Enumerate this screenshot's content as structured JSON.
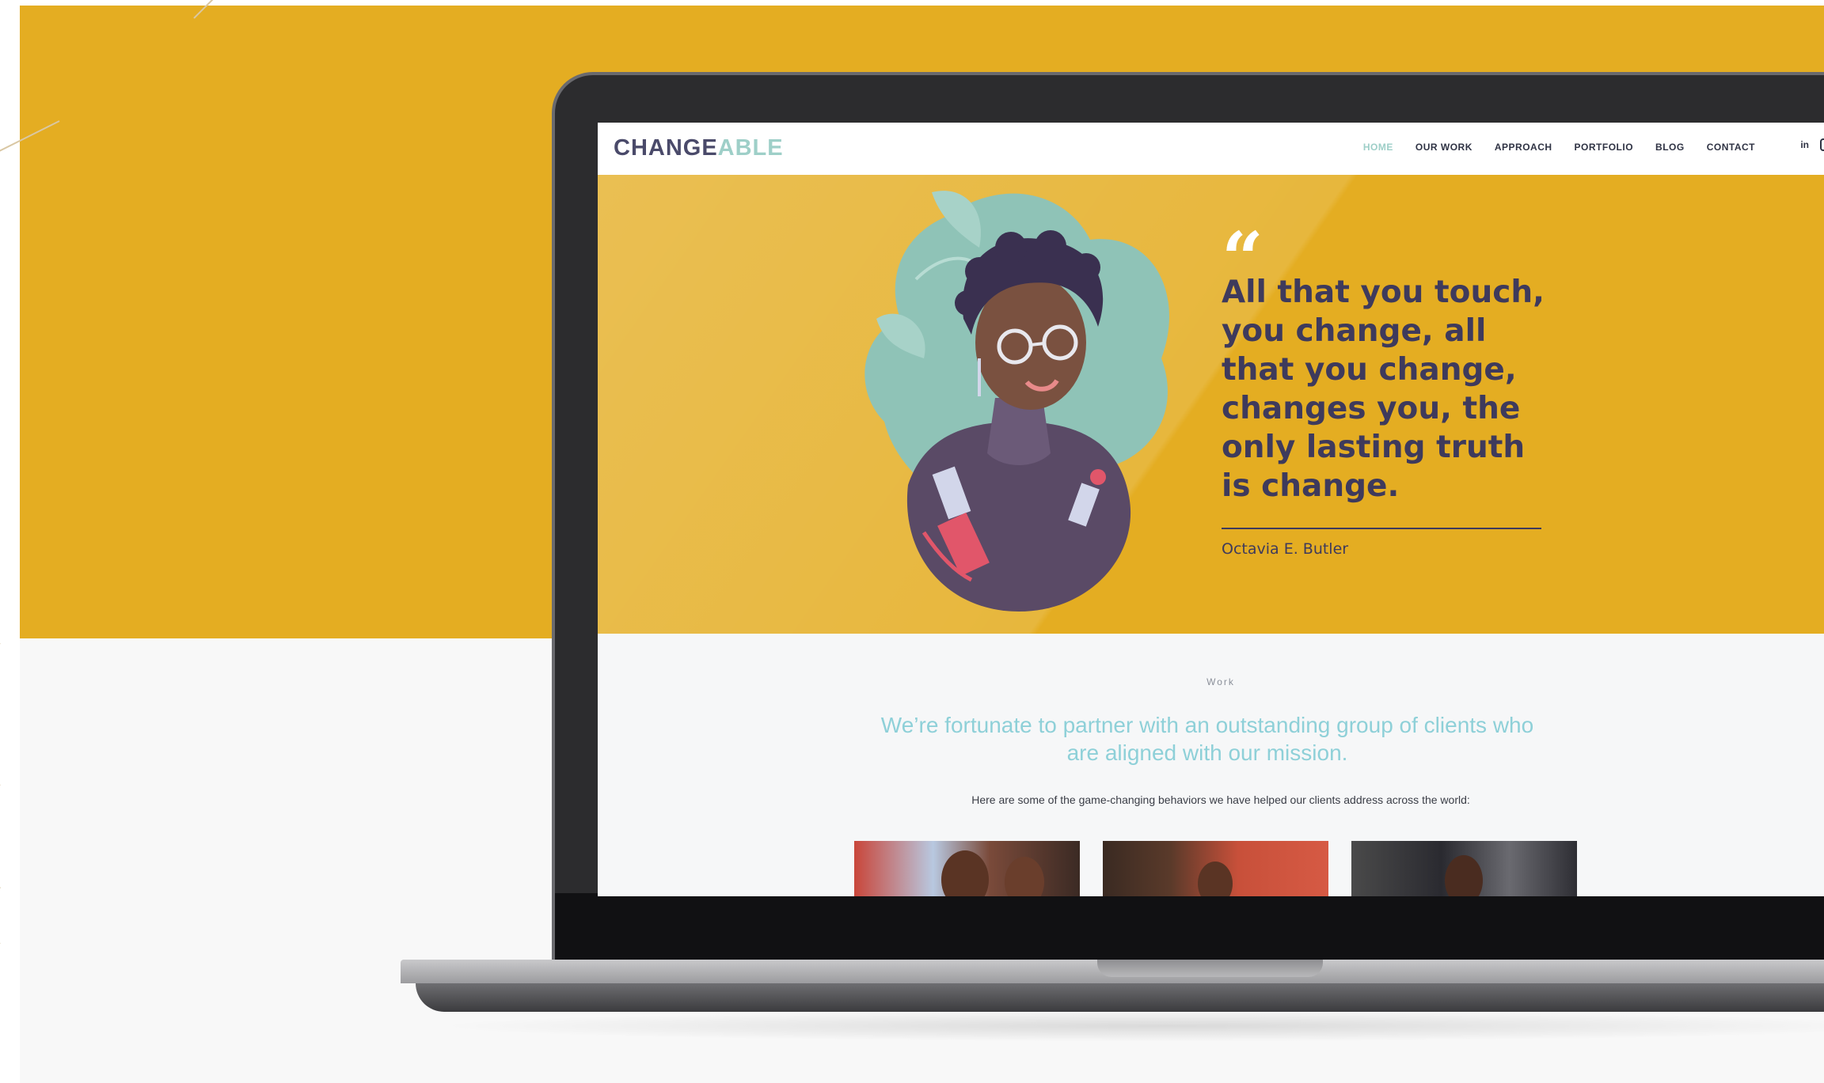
{
  "site": {
    "logo": {
      "part1": "CHANGE",
      "part2": "ABLE"
    },
    "nav": {
      "items": [
        {
          "label": "HOME",
          "active": true
        },
        {
          "label": "OUR WORK"
        },
        {
          "label": "APPROACH"
        },
        {
          "label": "PORTFOLIO"
        },
        {
          "label": "BLOG"
        },
        {
          "label": "CONTACT"
        }
      ],
      "social": {
        "linkedin": "in",
        "instagram_icon": "instagram-icon"
      }
    },
    "hero": {
      "quote_mark": "“",
      "quote": "All that you touch, you change, all that you change, changes you, the only lasting truth is change.",
      "author": "Octavia E. Butler"
    },
    "work": {
      "label": "Work",
      "headline": "We’re fortunate to partner with an outstanding group of clients who are aligned with our mission.",
      "sub": "Here are some of the game-changing behaviors we have helped our clients address across the world:"
    }
  },
  "colors": {
    "brand_yellow": "#e4ad22",
    "brand_navy": "#3e3a5c",
    "brand_teal": "#9ecfc8"
  }
}
